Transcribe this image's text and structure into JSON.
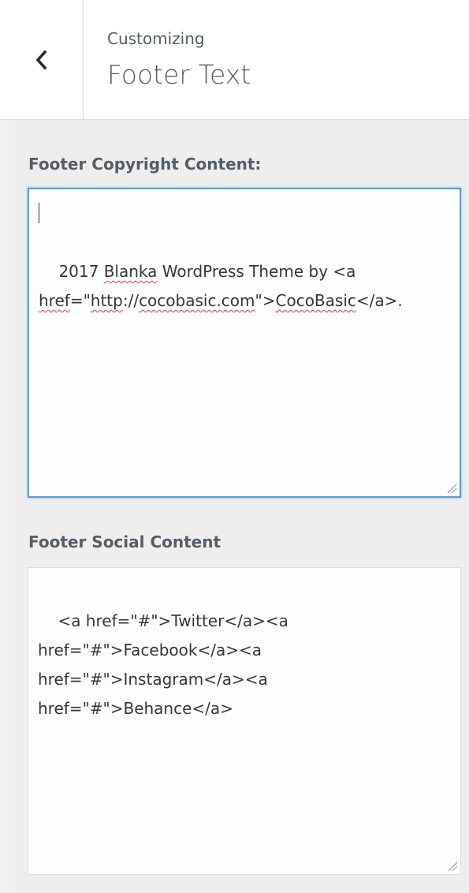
{
  "header": {
    "back_label": "Back",
    "subtitle": "Customizing",
    "title": "Footer Text"
  },
  "fields": [
    {
      "label": "Footer Copyright Content:",
      "value": "2017 Blanka WordPress Theme by <a href=\"http://cocobasic.com\">CocoBasic</a>.",
      "focused": true
    },
    {
      "label": "Footer Social Content",
      "value": "<a href=\"#\">Twitter</a><a href=\"#\">Facebook</a><a href=\"#\">Instagram</a><a href=\"#\">Behance</a>",
      "focused": false
    }
  ],
  "colors": {
    "focus_border": "#5b9dd9",
    "panel_bg": "#eeeeee",
    "text": "#555d66",
    "spellcheck": "#d63638"
  },
  "icons": {
    "back": "chevron-left-icon",
    "resize": "resize-grip-icon"
  }
}
